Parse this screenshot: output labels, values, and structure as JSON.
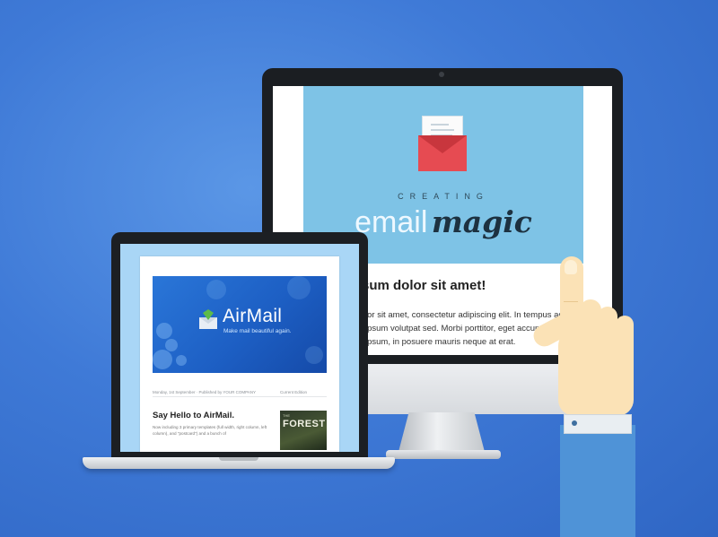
{
  "monitor": {
    "hero_kicker": "CREATING",
    "hero_title_light": "email",
    "hero_title_bold": "magic",
    "heading": "sum dolor sit amet!",
    "paragraph": "lor sit amet, consectetur adipiscing elit. In tempus adipiscing ipsum volutpat sed. Morbi porttitor, eget accumsan ro ultricies ipsum, in posuere mauris neque at erat."
  },
  "laptop": {
    "brand_title": "AirMail",
    "brand_tagline": "Make mail beautiful again.",
    "post_meta": "Monday, 1st September · Published by YOUR COMPANY",
    "sidebar_label": "Current Edition",
    "post_heading": "Say Hello to AirMail.",
    "post_excerpt": "Now including 3 primary templates (full width, right column, left column), and \"postcard\") and a bunch of",
    "thumb_kicker": "THE",
    "thumb_title": "FOREST"
  },
  "icons": {
    "envelope": "envelope-letter-icon",
    "airmail": "airmail-envelope-icon",
    "hand": "pointing-hand"
  },
  "colors": {
    "background": "#3f7ad7",
    "hero": "#7ec3e6",
    "envelope": "#e64b52",
    "banner": "#1d5fc4",
    "sleeve": "#4f93d7"
  }
}
